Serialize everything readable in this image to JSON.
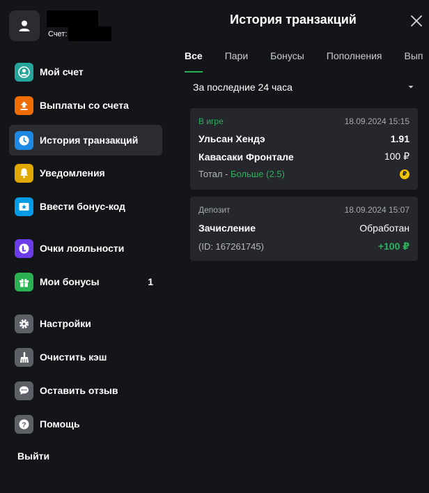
{
  "user": {
    "account_label": "Счет:"
  },
  "menu": {
    "items": [
      {
        "label": "Мой счет",
        "icon": "user-circle-icon",
        "color": "#26a69a"
      },
      {
        "label": "Выплаты со счета",
        "icon": "upload-icon",
        "color": "#ef6c00"
      },
      {
        "label": "История транзакций",
        "icon": "clock-icon",
        "color": "#1e88e5"
      },
      {
        "label": "Уведомления",
        "icon": "bell-icon",
        "color": "#e0a800"
      },
      {
        "label": "Ввести бонус-код",
        "icon": "ticket-star-icon",
        "color": "#039be5"
      },
      {
        "label": "Очки лояльности",
        "icon": "loyalty-coin-icon",
        "color": "#6a3de8"
      },
      {
        "label": "Мои бонусы",
        "icon": "gift-icon",
        "color": "#2bb052",
        "count": "1"
      },
      {
        "label": "Настройки",
        "icon": "gear-icon",
        "color": "#5c5f66"
      },
      {
        "label": "Очистить кэш",
        "icon": "broom-icon",
        "color": "#5c5f66"
      },
      {
        "label": "Оставить отзыв",
        "icon": "chat-bubble-icon",
        "color": "#5c5f66"
      },
      {
        "label": "Помощь",
        "icon": "help-icon",
        "color": "#5c5f66"
      }
    ],
    "logout": "Выйти"
  },
  "main": {
    "title": "История транзакций",
    "tabs": [
      {
        "label": "Все"
      },
      {
        "label": "Пари"
      },
      {
        "label": "Бонусы"
      },
      {
        "label": "Пополнения"
      },
      {
        "label": "Вып"
      }
    ],
    "period": "За последние 24 часа",
    "transactions": [
      {
        "status": "В игре",
        "datetime": "18.09.2024 15:15",
        "team1": "Ульсан Хендэ",
        "odds": "1.91",
        "team2": "Кавасаки Фронтале",
        "stake": "100 ₽",
        "bet_prefix": "Тотал - ",
        "bet_value": "Больше (2.5)",
        "coin_symbol": "₽"
      },
      {
        "type": "Депозит",
        "datetime": "18.09.2024 15:07",
        "title": "Зачисление",
        "status": "Обработан",
        "id": "(ID: 167261745)",
        "amount": "+100 ₽"
      }
    ]
  },
  "colors": {
    "background": "#141518",
    "accent": "#2fb05f",
    "card": "#25272c",
    "active_item": "#2a2c31"
  }
}
